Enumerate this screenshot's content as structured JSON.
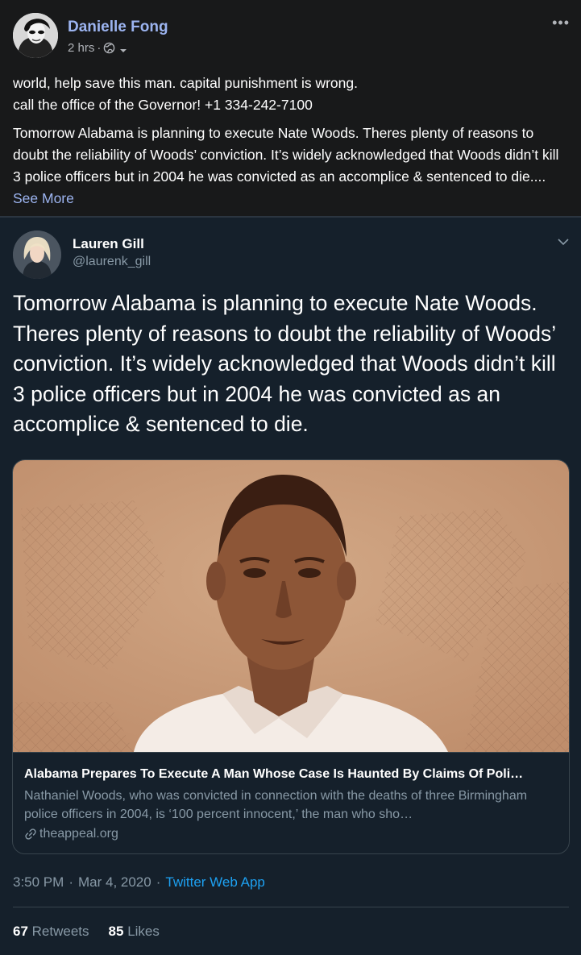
{
  "facebook_post": {
    "author": "Danielle Fong",
    "time": "2 hrs",
    "separator": "·",
    "more_icon": "ellipsis-icon",
    "privacy_icon": "globe-icon",
    "lines": [
      "world, help save this man. capital punishment is wrong.",
      "call the office of the Governor! +1 334-242-7100"
    ],
    "body": "Tomorrow Alabama is planning to execute Nate Woods. Theres plenty of reasons to doubt the reliability of Woods’ conviction. It’s widely acknowledged that Woods didn’t kill 3 police officers but in 2004 he was convicted as an accomplice & sentenced to die....",
    "see_more": "See More"
  },
  "tweet": {
    "author": "Lauren Gill",
    "handle": "@laurenk_gill",
    "text": "Tomorrow Alabama is planning to execute Nate Woods. Theres plenty of reasons to doubt the reliability of Woods’ conviction. It’s widely acknowledged that Woods didn’t kill 3 police officers but in 2004 he was convicted as an accomplice & sentenced to die.",
    "card": {
      "title": "Alabama Prepares To Execute A Man Whose Case Is Haunted By Claims Of Poli…",
      "description": "Nathaniel Woods, who was convicted in connection with the deaths of three Birmingham police officers in 2004, is ‘100 percent innocent,’ the man who sho…",
      "domain": "theappeal.org",
      "image_tint": "#c39372"
    },
    "time": "3:50 PM",
    "date": "Mar 4, 2020",
    "dot": "·",
    "source": "Twitter Web App",
    "stats": {
      "retweets_count": "67",
      "retweets_label": "Retweets",
      "likes_count": "85",
      "likes_label": "Likes"
    }
  },
  "colors": {
    "fb_bg": "#18191a",
    "twitter_bg": "#15202b",
    "link_blue": "#1da1f2",
    "fb_link": "#9cb4f0"
  }
}
